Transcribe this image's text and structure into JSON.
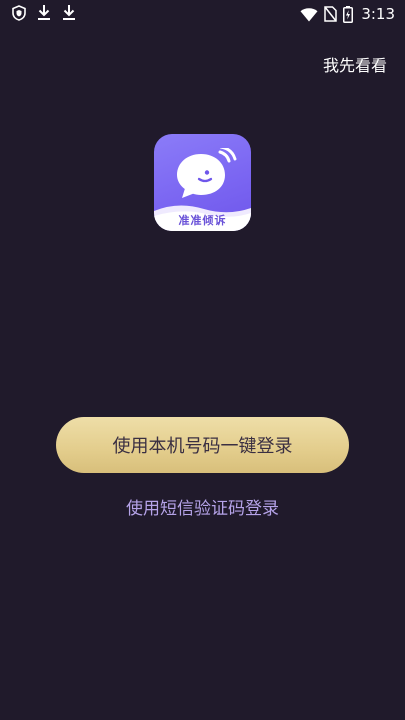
{
  "status_bar": {
    "time": "3:13",
    "icons_left": [
      "shield-icon",
      "download-icon",
      "download-icon"
    ],
    "icons_right": [
      "wifi-icon",
      "no-sim-icon",
      "battery-charging-icon"
    ]
  },
  "header": {
    "skip_label": "我先看看"
  },
  "logo": {
    "app_name": "准准倾诉",
    "icon": "chat-bubble-icon"
  },
  "login": {
    "one_click_label": "使用本机号码一键登录",
    "sms_label": "使用短信验证码登录"
  },
  "colors": {
    "background": "#201a2b",
    "primary_button": "#e6d397",
    "secondary_link": "#b5a3e8",
    "logo_gradient": "#7b66f2"
  }
}
